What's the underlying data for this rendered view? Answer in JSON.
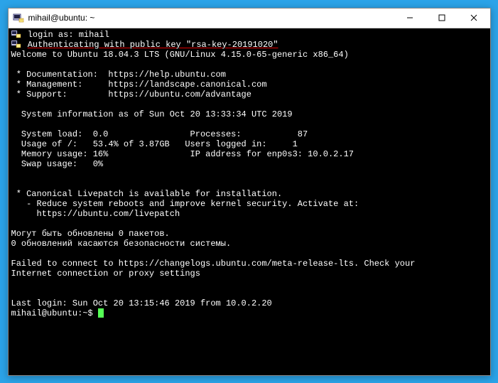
{
  "titlebar": {
    "title": "mihail@ubuntu: ~"
  },
  "term": {
    "login_prompt": "login as: ",
    "login_user": "mihail",
    "auth_line": "Authenticating with public key \"rsa-key-20191020\"",
    "welcome": "Welcome to Ubuntu 18.04.3 LTS (GNU/Linux 4.15.0-65-generic x86_64)",
    "doc_label": " * Documentation:  ",
    "doc_url": "https://help.ubuntu.com",
    "mgmt_label": " * Management:     ",
    "mgmt_url": "https://landscape.canonical.com",
    "support_label": " * Support:        ",
    "support_url": "https://ubuntu.com/advantage",
    "sysinfo_header": "  System information as of Sun Oct 20 13:33:34 UTC 2019",
    "sys_load": "  System load:  0.0                Processes:           87",
    "usage": "  Usage of /:   53.4% of 3.87GB   Users logged in:     1",
    "mem": "  Memory usage: 16%                IP address for enp0s3: 10.0.2.17",
    "swap": "  Swap usage:   0%",
    "livepatch1": " * Canonical Livepatch is available for installation.",
    "livepatch2": "   - Reduce system reboots and improve kernel security. Activate at:",
    "livepatch3": "     https://ubuntu.com/livepatch",
    "ru1": "Могут быть обновлены 0 пакетов.",
    "ru2": "0 обновлений касаются безопасности системы.",
    "fail1": "Failed to connect to https://changelogs.ubuntu.com/meta-release-lts. Check your",
    "fail2": "Internet connection or proxy settings",
    "lastlogin": "Last login: Sun Oct 20 13:15:46 2019 from 10.0.2.20",
    "prompt": "mihail@ubuntu:~$ "
  }
}
